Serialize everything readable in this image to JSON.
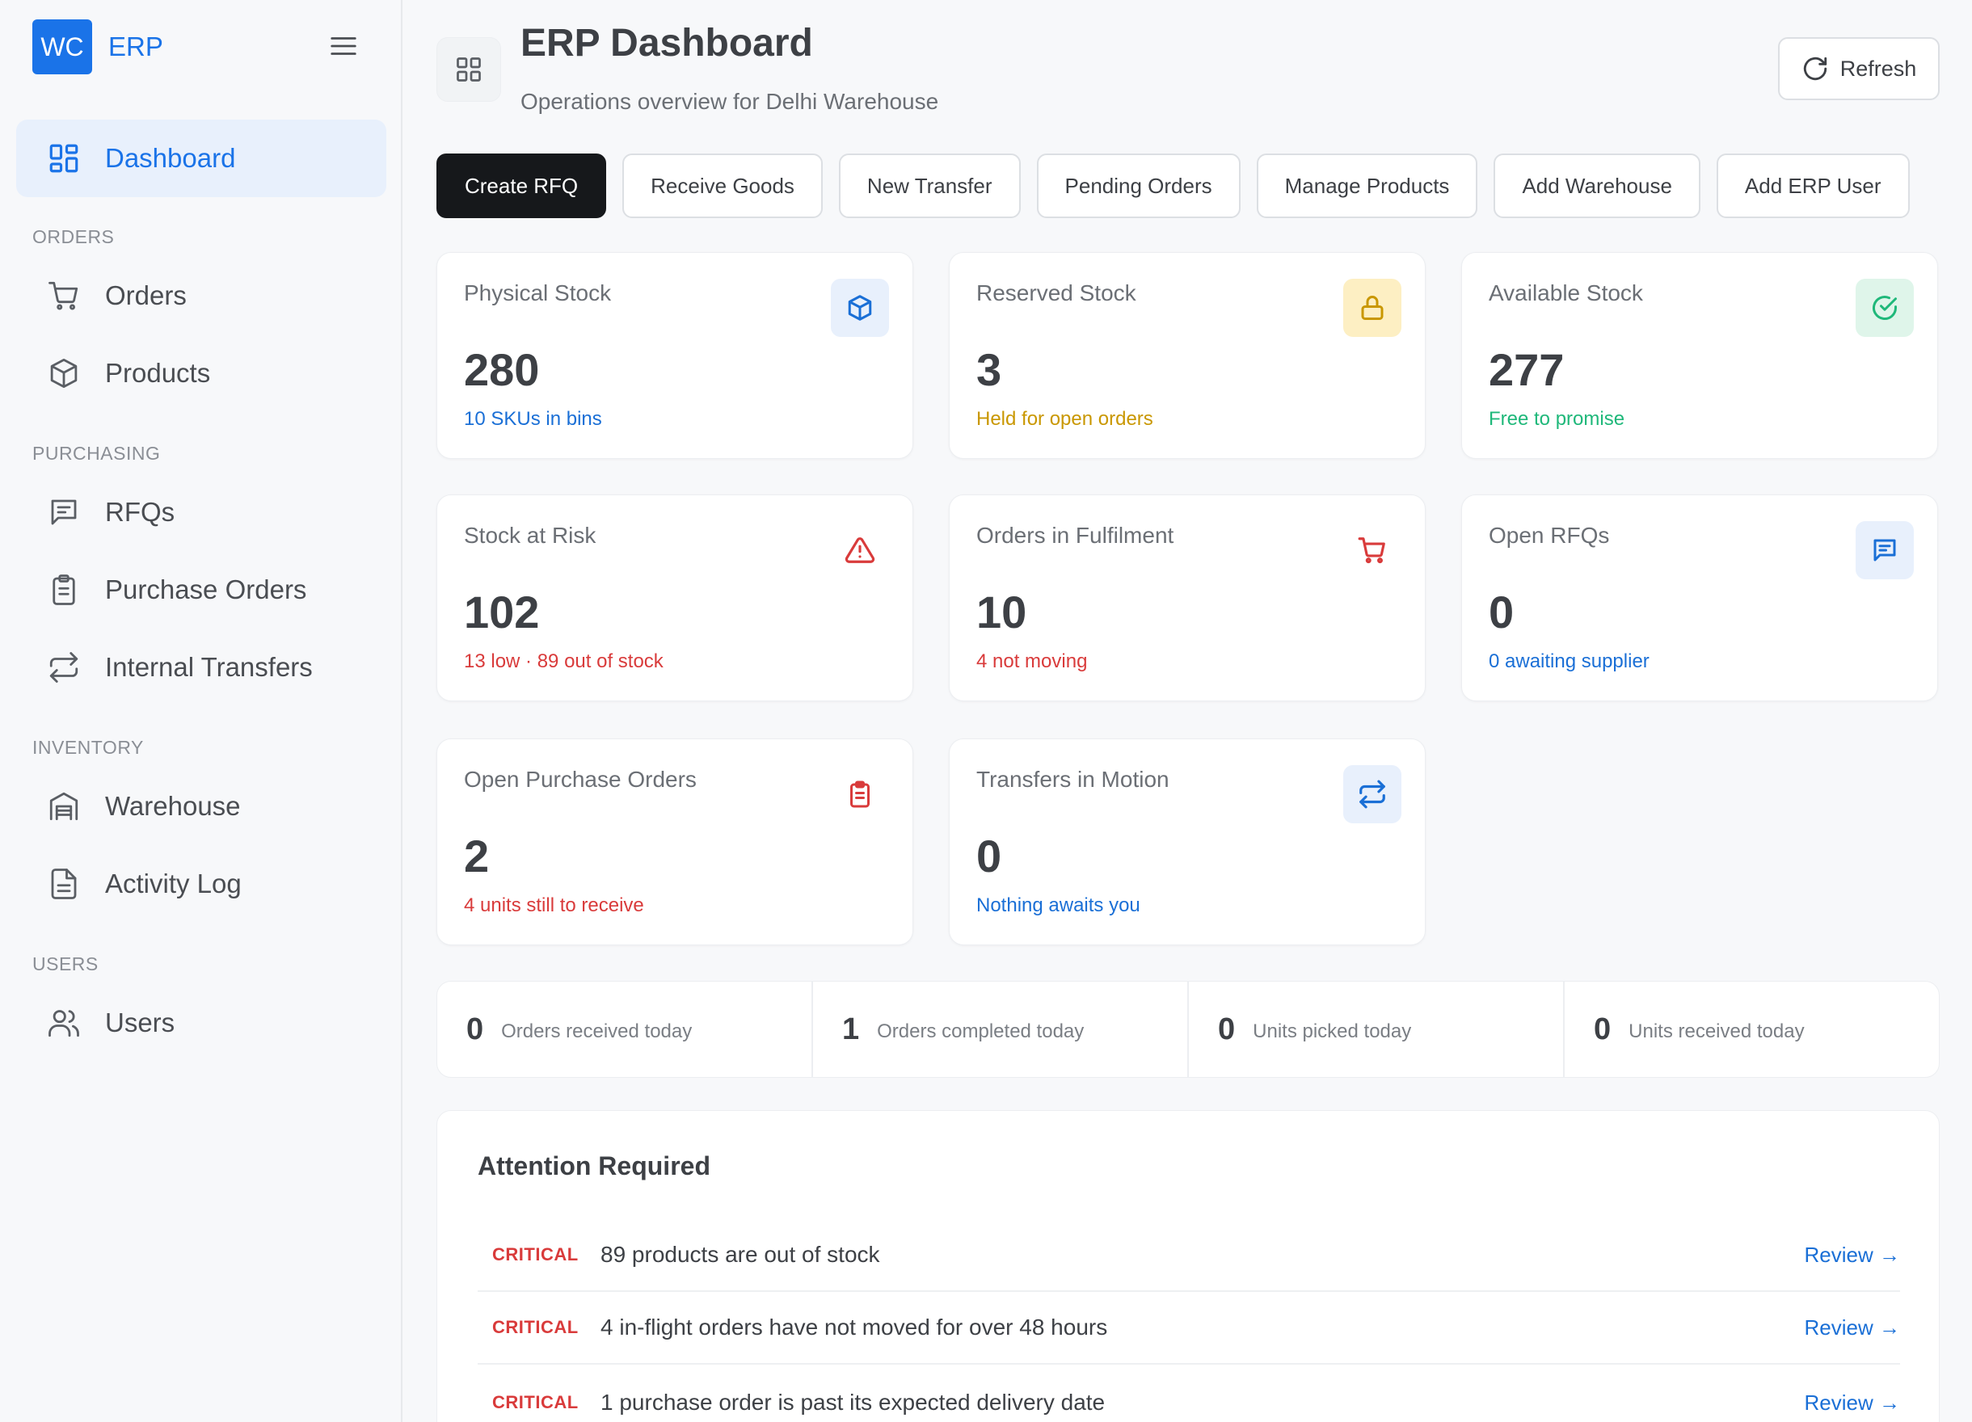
{
  "brand": {
    "logo_text": "WC",
    "name": "ERP"
  },
  "sidebar": {
    "dashboard": "Dashboard",
    "sections": {
      "orders": "ORDERS",
      "purchasing": "PURCHASING",
      "inventory": "INVENTORY",
      "users": "USERS"
    },
    "items": {
      "orders": "Orders",
      "products": "Products",
      "rfqs": "RFQs",
      "purchase_orders": "Purchase Orders",
      "internal_transfers": "Internal Transfers",
      "warehouse": "Warehouse",
      "activity_log": "Activity Log",
      "users": "Users"
    }
  },
  "header": {
    "title": "ERP Dashboard",
    "subtitle": "Operations overview for Delhi Warehouse",
    "refresh": "Refresh"
  },
  "actions": [
    "Create RFQ",
    "Receive Goods",
    "New Transfer",
    "Pending Orders",
    "Manage Products",
    "Add Warehouse",
    "Add ERP User"
  ],
  "cards": [
    {
      "label": "Physical Stock",
      "value": "280",
      "sub": "10 SKUs in bins",
      "icon": "box-icon",
      "accent": "#1a6fd6",
      "icon_bg": "#e8f0fc"
    },
    {
      "label": "Reserved Stock",
      "value": "3",
      "sub": "Held for open orders",
      "icon": "lock-icon",
      "accent": "#c99700",
      "icon_bg": "#fdefc3"
    },
    {
      "label": "Available Stock",
      "value": "277",
      "sub": "Free to promise",
      "icon": "check-circle-icon",
      "accent": "#1fb87a",
      "icon_bg": "#dff5ea"
    },
    {
      "label": "Stock at Risk",
      "value": "102",
      "sub": "13 low · 89 out of stock",
      "icon": "warning-icon",
      "accent": "#d93b3b",
      "icon_bg": "#ffffff"
    },
    {
      "label": "Orders in Fulfilment",
      "value": "10",
      "sub": "4 not moving",
      "icon": "cart-icon",
      "accent": "#d93b3b",
      "icon_bg": "#ffffff"
    },
    {
      "label": "Open RFQs",
      "value": "0",
      "sub": "0 awaiting supplier",
      "icon": "message-icon",
      "accent": "#1a6fd6",
      "icon_bg": "#e8f0fc"
    },
    {
      "label": "Open Purchase Orders",
      "value": "2",
      "sub": "4 units still to receive",
      "icon": "clipboard-icon",
      "accent": "#d93b3b",
      "icon_bg": "#ffffff"
    },
    {
      "label": "Transfers in Motion",
      "value": "0",
      "sub": "Nothing awaits you",
      "icon": "transfer-icon",
      "accent": "#1a6fd6",
      "icon_bg": "#e8f0fc"
    }
  ],
  "today": [
    {
      "value": "0",
      "label": "Orders received today"
    },
    {
      "value": "1",
      "label": "Orders completed today"
    },
    {
      "value": "0",
      "label": "Units picked today"
    },
    {
      "value": "0",
      "label": "Units received today"
    }
  ],
  "attention": {
    "title": "Attention Required",
    "link_text": "Review →",
    "rows": [
      {
        "level": "CRITICAL",
        "message": "89 products are out of stock"
      },
      {
        "level": "CRITICAL",
        "message": "4 in-flight orders have not moved for over 48 hours"
      },
      {
        "level": "CRITICAL",
        "message": "1 purchase order is past its expected delivery date"
      }
    ]
  }
}
